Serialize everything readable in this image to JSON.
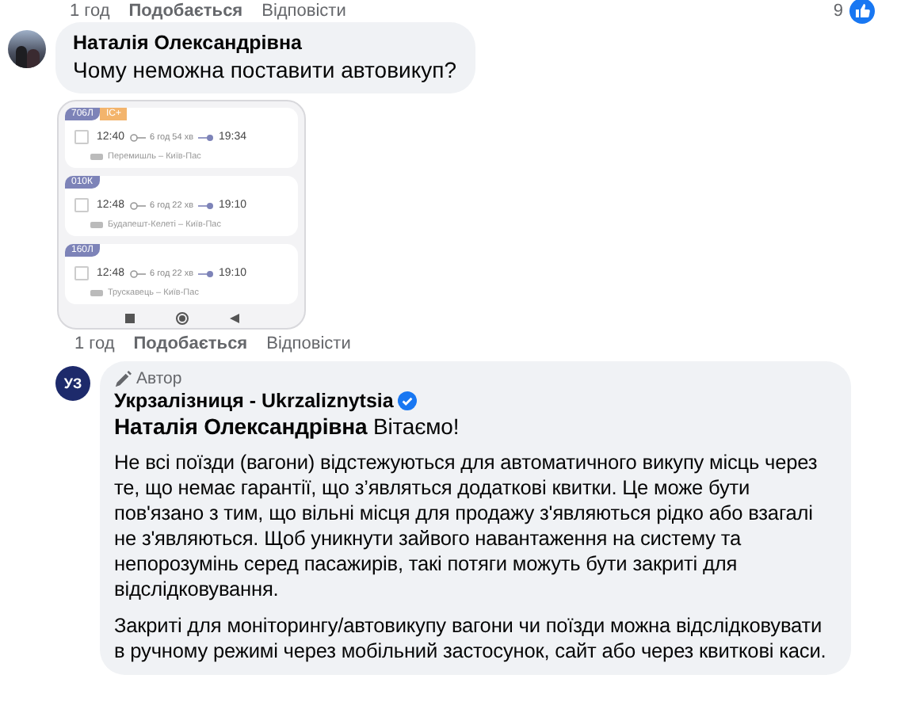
{
  "previous_meta": {
    "time": "1 год",
    "like": "Подобається",
    "reply": "Відповісти",
    "reaction_count": "9"
  },
  "comment": {
    "author": "Наталія Олександрівна",
    "text": "Чому неможна поставити автовикуп?",
    "attachment": {
      "trains": [
        {
          "tags": [
            {
              "text": "706Л",
              "color": "#7d83b8"
            },
            {
              "text": "ІС+",
              "color": "#f3b46c"
            }
          ],
          "checked": false,
          "departure": "12:40",
          "duration": "6 год 54 хв",
          "arrival": "19:34",
          "route": "Перемишль – Київ-Пас"
        },
        {
          "tags": [
            {
              "text": "010К",
              "color": "#7d83b8"
            }
          ],
          "checked": false,
          "departure": "12:48",
          "duration": "6 год 22 хв",
          "arrival": "19:10",
          "route": "Будапешт-Келеті – Київ-Пас"
        },
        {
          "tags": [
            {
              "text": "160Л",
              "color": "#7d83b8"
            }
          ],
          "checked": false,
          "departure": "12:48",
          "duration": "6 год 22 хв",
          "arrival": "19:10",
          "route": "Трускавець – Київ-Пас"
        }
      ]
    },
    "meta": {
      "time": "1 год",
      "like": "Подобається",
      "reply": "Відповісти"
    }
  },
  "reply": {
    "badge": "Автор",
    "author": "Укрзалізниця - Ukrzaliznytsia",
    "verified": true,
    "avatar_text": "УЗ",
    "paragraphs": [
      "**Наталія Олександрівна** Вітаємо!",
      "Не всі поїзди (вагони) відстежуються для автоматичного викупу місць через те, що немає гарантії, що з’являться додаткові квитки. Це може бути пов'язано з тим, що вільні місця для продажу з'являються рідко або взагалі не з'являються. Щоб уникнути зайвого навантаження на систему та непорозумінь серед пасажирів, такі потяги можуть бути закриті для відслідковування.",
      "Закриті для моніторингу/автовикупу вагони чи поїзди можна відслідковувати в ручному режимі через мобільний застосунок, сайт або через квиткові каси."
    ]
  }
}
